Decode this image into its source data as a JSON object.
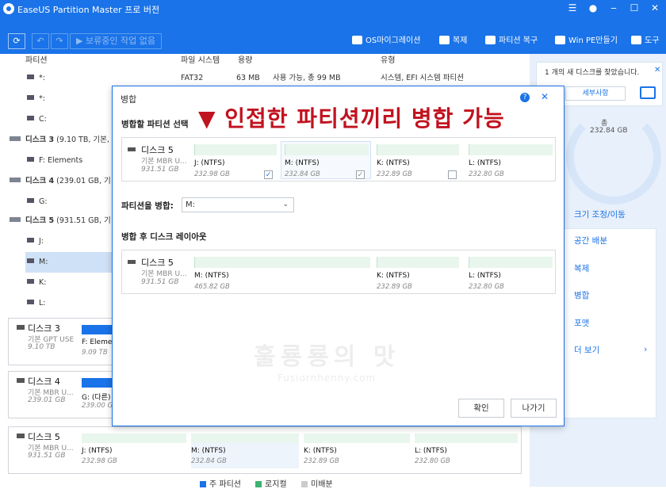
{
  "titlebar": {
    "title": "EaseUS Partition Master 프로 버전"
  },
  "toolbar": {
    "undo_pending": "보류중인 작업 없음",
    "actions": [
      {
        "label": "OS마이그레이션",
        "icon": "migrate-icon"
      },
      {
        "label": "복제",
        "icon": "clone-icon"
      },
      {
        "label": "파티션 복구",
        "icon": "recovery-icon"
      },
      {
        "label": "Win PE만들기",
        "icon": "windows-icon"
      },
      {
        "label": "도구",
        "icon": "tools-icon"
      }
    ]
  },
  "table": {
    "headers": [
      "파티션",
      "파일 시스템",
      "용량",
      "유형"
    ],
    "rows": [
      {
        "name": "*:",
        "fs": "FAT32",
        "cap": "63 MB",
        "used": "사용 가능, 총  99 MB",
        "type": "시스템, EFI 시스템 파티션"
      },
      {
        "name": "*:",
        "fs": "",
        "cap": "",
        "used": "",
        "type": ""
      },
      {
        "name": "C:",
        "fs": "",
        "cap": "",
        "used": "",
        "type": ""
      },
      {
        "name": "디스크 3",
        "extra": "(9.10 TB, 기본,"
      },
      {
        "name": "F: Elements"
      },
      {
        "name": "디스크 4",
        "extra": "(239.01 GB, 기"
      },
      {
        "name": "G:"
      },
      {
        "name": "디스크 5",
        "extra": "(931.51 GB, 기"
      },
      {
        "name": "J:"
      },
      {
        "name": "M:"
      },
      {
        "name": "K:"
      },
      {
        "name": "L:"
      }
    ]
  },
  "diskmaps": [
    {
      "name": "디스크 3",
      "type": "기본 GPT USE",
      "size": "9.10 TB",
      "parts": [
        {
          "label": "F: Elemen",
          "size": "9.09 TB"
        }
      ]
    },
    {
      "name": "디스크 4",
      "type": "기본 MBR U...",
      "size": "239.01 GB",
      "parts": [
        {
          "label": "G: (다른)",
          "size": "239.00 GB"
        }
      ]
    },
    {
      "name": "디스크 5",
      "type": "기본 MBR U...",
      "size": "931.51 GB",
      "parts": [
        {
          "label": "J: (NTFS)",
          "size": "232.98 GB"
        },
        {
          "label": "M: (NTFS)",
          "size": "232.84 GB"
        },
        {
          "label": "K: (NTFS)",
          "size": "232.89 GB"
        },
        {
          "label": "L: (NTFS)",
          "size": "232.80 GB"
        }
      ]
    }
  ],
  "legend": {
    "primary": "주 파티션",
    "logical": "로지컬",
    "unallocated": "미배분"
  },
  "legend_colors": {
    "primary": "#1a73e8",
    "logical": "#3cb371",
    "unallocated": "#cccccc"
  },
  "rightpanel": {
    "notice": "개의 새 디스크를 찾았습니다.",
    "notice_count": "1",
    "details": "세부사항",
    "total_label": "총",
    "total_size": "232.84 GB",
    "actions": [
      "크기 조정/이동",
      "공간 배분",
      "복제",
      "병합",
      "포맷",
      "더 보기"
    ]
  },
  "dialog": {
    "title": "병합",
    "help": "?",
    "close": "✕",
    "section1": "병합할 파티션 선택",
    "section2": "파티션을 병합:",
    "section3": "병합 후 디스크 레이아웃",
    "merge_target": "M:",
    "disk": {
      "name": "디스크 5",
      "type": "기본 MBR U...",
      "size": "931.51 GB"
    },
    "select_parts": [
      {
        "label": "J: (NTFS)",
        "size": "232.98 GB",
        "checked": true
      },
      {
        "label": "M: (NTFS)",
        "size": "232.84 GB",
        "checked": true
      },
      {
        "label": "K: (NTFS)",
        "size": "232.89 GB",
        "checked": false
      },
      {
        "label": "L: (NTFS)",
        "size": "232.80 GB",
        "checked": false
      }
    ],
    "after_parts": [
      {
        "label": "M: (NTFS)",
        "size": "465.82 GB"
      },
      {
        "label": "K: (NTFS)",
        "size": "232.89 GB"
      },
      {
        "label": "L: (NTFS)",
        "size": "232.80 GB"
      }
    ],
    "ok": "확인",
    "cancel": "나가기"
  },
  "annotation": "▼ 인접한 파티션끼리 병합 가능",
  "watermark": {
    "main": "훌룡룡의 맛",
    "sub": "Fusiornhenny.com"
  }
}
